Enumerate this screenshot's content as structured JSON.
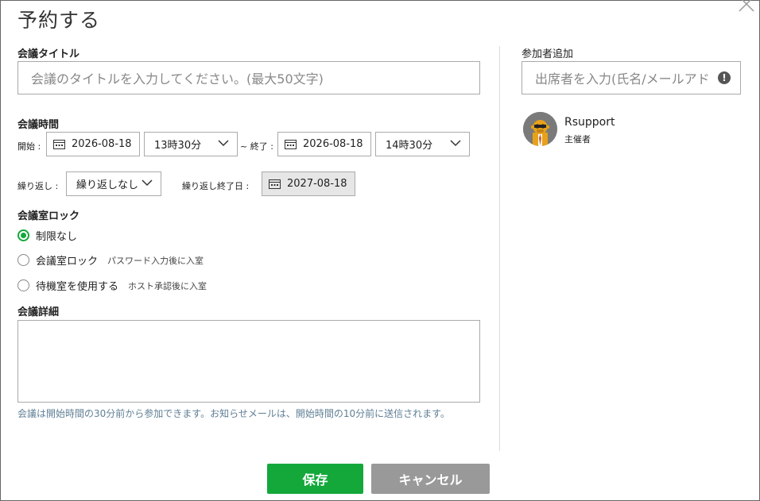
{
  "dialog": {
    "title": "予約する"
  },
  "meeting_title": {
    "label": "会議タイトル",
    "placeholder": "会議のタイトルを入力してください。(最大50文字)"
  },
  "meeting_time": {
    "label": "会議時間",
    "start_label": "開始 :",
    "start_date": "2026-08-18",
    "start_time": "13時30分",
    "end_label": "~ 終了 :",
    "end_date": "2026-08-18",
    "end_time": "14時30分"
  },
  "repeat": {
    "label": "繰り返し :",
    "value": "繰り返しなし",
    "end_label": "繰り返し終了日 :",
    "end_date": "2027-08-18"
  },
  "room_lock": {
    "label": "会議室ロック",
    "options": [
      {
        "label": "制限なし",
        "sub": "",
        "selected": true
      },
      {
        "label": "会議室ロック",
        "sub": "パスワード入力後に入室",
        "selected": false
      },
      {
        "label": "待機室を使用する",
        "sub": "ホスト承認後に入室",
        "selected": false
      }
    ]
  },
  "details": {
    "label": "会議詳細",
    "notice": "会議は開始時間の30分前から参加できます。お知らせメールは、開始時間の10分前に送信されます。"
  },
  "participants": {
    "label": "参加者追加",
    "placeholder": "出席者を入力(氏名/メールアドレス)",
    "host_name": "Rsupport",
    "host_role": "主催者"
  },
  "actions": {
    "save": "保存",
    "cancel": "キャンセル"
  },
  "colors": {
    "accent": "#14a83b",
    "cancel": "#999999",
    "notice": "#5f7f95"
  }
}
